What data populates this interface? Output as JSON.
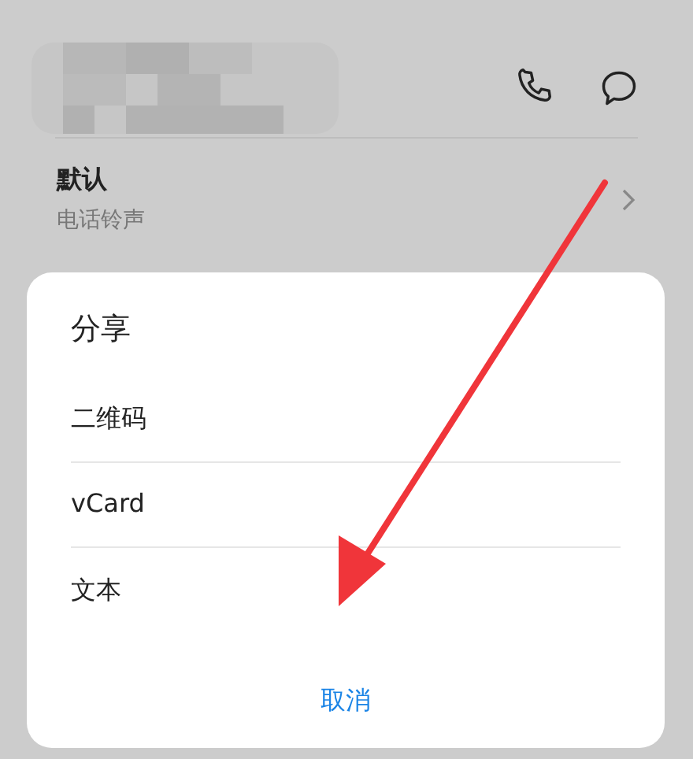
{
  "ringtone": {
    "value": "默认",
    "label": "电话铃声"
  },
  "share_dialog": {
    "title": "分享",
    "options": [
      {
        "label": "二维码"
      },
      {
        "label": "vCard"
      },
      {
        "label": "文本"
      }
    ],
    "cancel": "取消"
  }
}
